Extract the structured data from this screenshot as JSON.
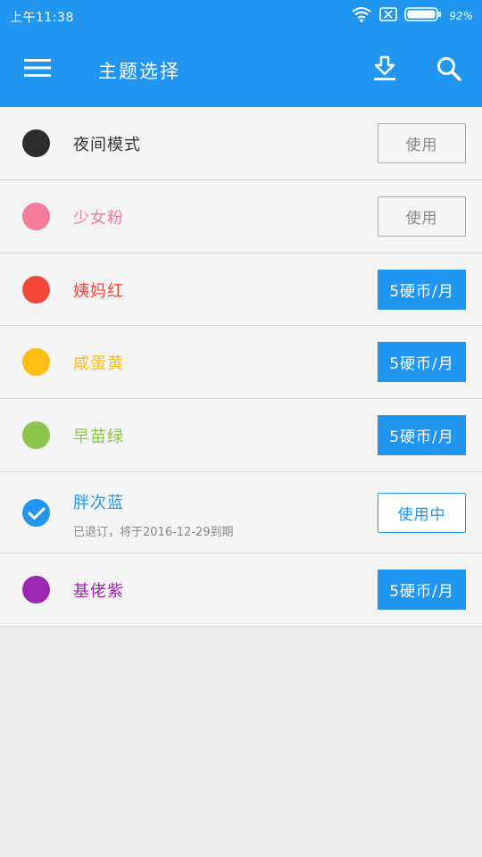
{
  "status": {
    "time": "上午11:38",
    "battery": "92%"
  },
  "header": {
    "title": "主题选择",
    "icons": [
      "menu-icon",
      "download-icon",
      "search-icon"
    ]
  },
  "colors": {
    "primary": "#2196f0",
    "background": "#ebebeb"
  },
  "themes": [
    {
      "name": "夜间模式",
      "color": "#2c2c2c",
      "action": "使用"
    },
    {
      "name": "少女粉",
      "color": "#f57a9b",
      "action": "使用"
    },
    {
      "name": "姨妈红",
      "color": "#f2463a",
      "action": "5硬币/月"
    },
    {
      "name": "咸蛋黄",
      "color": "#fdbd14",
      "action": "5硬币/月"
    },
    {
      "name": "早苗绿",
      "color": "#8dc44c",
      "action": "5硬币/月"
    },
    {
      "name": "胖次蓝",
      "color": "#2196f0",
      "action": "使用中",
      "subtitle": "已退订，将于2016-12-29到期",
      "selected": true
    },
    {
      "name": "基佬紫",
      "color": "#9c27b0",
      "action": "5硬币/月"
    }
  ]
}
